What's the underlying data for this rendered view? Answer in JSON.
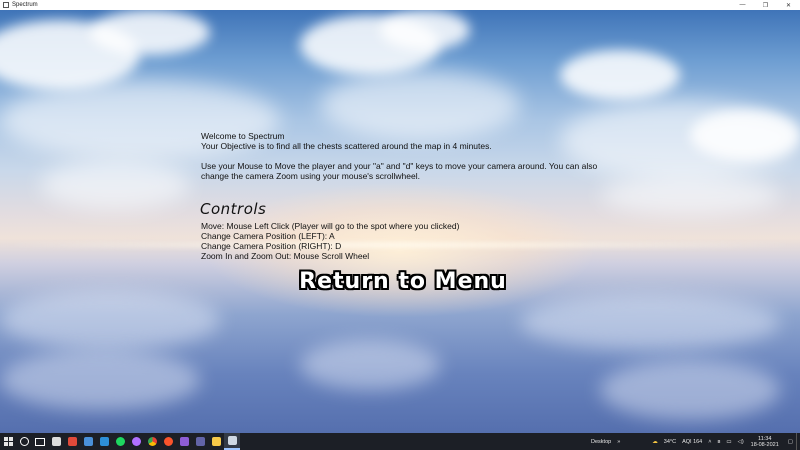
{
  "window": {
    "title": "Spectrum",
    "controls": {
      "minimize": "—",
      "maximize": "❐",
      "close": "✕"
    }
  },
  "intro": {
    "welcome": "Welcome to Spectrum",
    "objective": "Your Objective is to find all the chests scattered around the map in 4 minutes.",
    "movement_line1": "Use your Mouse to Move the player and your \"a\" and \"d\" keys to move your camera around. You can also",
    "movement_line2": "change the camera Zoom using your mouse's scrollwheel."
  },
  "controls": {
    "heading": "Controls",
    "items": [
      "Move: Mouse Left Click (Player will go to the spot where you clicked)",
      "Change Camera Position (LEFT): A",
      "Change Camera Position (RIGHT): D",
      "Zoom In and Zoom Out: Mouse Scroll Wheel"
    ]
  },
  "menu": {
    "return_label": "Return to Menu"
  },
  "taskbar": {
    "apps": [
      {
        "name": "search-icon",
        "color": "#ffffff"
      },
      {
        "name": "task-view-icon",
        "color": "#ffffff"
      },
      {
        "name": "unity-icon",
        "color": "#dddddd"
      },
      {
        "name": "calendar-icon",
        "color": "#e04a3a"
      },
      {
        "name": "editor-icon",
        "color": "#4a90d9"
      },
      {
        "name": "vscode-icon",
        "color": "#2d8fd8"
      },
      {
        "name": "spotify-icon",
        "color": "#1ed760"
      },
      {
        "name": "github-icon",
        "color": "#b070ff"
      },
      {
        "name": "chrome-icon",
        "color": "#f2c232"
      },
      {
        "name": "brave-icon",
        "color": "#fb542b"
      },
      {
        "name": "visual-studio-icon",
        "color": "#8e5dd6"
      },
      {
        "name": "teams-icon",
        "color": "#6264a7"
      },
      {
        "name": "file-explorer-icon",
        "color": "#f7c948"
      },
      {
        "name": "spectrum-app-icon",
        "color": "#cfd8e3"
      }
    ],
    "desktop_label": "Desktop",
    "overflow": "»",
    "weather": "34°C",
    "aqi": "AQI 164",
    "time": "11:34",
    "date": "18-08-2021"
  }
}
